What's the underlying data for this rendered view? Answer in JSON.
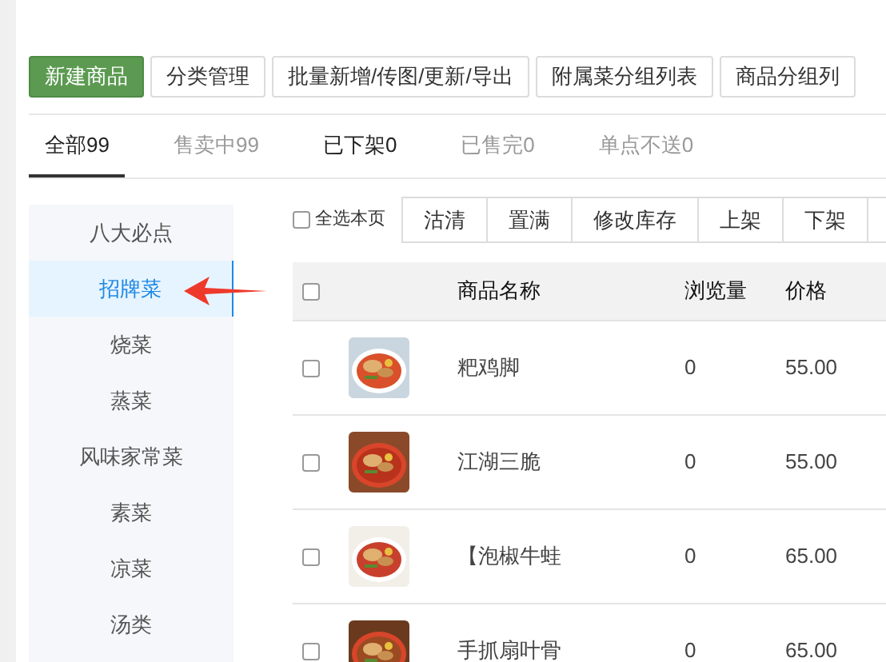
{
  "actions": [
    {
      "label": "新建商品",
      "kind": "primary"
    },
    {
      "label": "分类管理",
      "kind": "default"
    },
    {
      "label": "批量新增/传图/更新/导出",
      "kind": "default"
    },
    {
      "label": "附属菜分组列表",
      "kind": "default"
    },
    {
      "label": "商品分组列",
      "kind": "default"
    }
  ],
  "tabs": [
    {
      "label": "全部99",
      "selected": true,
      "muted": false
    },
    {
      "label": "售卖中99",
      "selected": false,
      "muted": true
    },
    {
      "label": "已下架0",
      "selected": false,
      "muted": false
    },
    {
      "label": "已售完0",
      "selected": false,
      "muted": true
    },
    {
      "label": "单点不送0",
      "selected": false,
      "muted": true
    }
  ],
  "categories": [
    {
      "label": "八大必点",
      "selected": false
    },
    {
      "label": "招牌菜",
      "selected": true
    },
    {
      "label": "烧菜",
      "selected": false
    },
    {
      "label": "蒸菜",
      "selected": false
    },
    {
      "label": "风味家常菜",
      "selected": false
    },
    {
      "label": "素菜",
      "selected": false
    },
    {
      "label": "凉菜",
      "selected": false
    },
    {
      "label": "汤类",
      "selected": false
    }
  ],
  "toolbar": {
    "select_all": {
      "label": "全选本页",
      "checked": false
    },
    "buttons": [
      "沽清",
      "置满",
      "修改库存",
      "上架",
      "下架"
    ]
  },
  "table": {
    "header_checked": false,
    "columns": [
      "商品名称",
      "浏览量",
      "价格"
    ],
    "rows": [
      {
        "checked": false,
        "name": "粑鸡脚",
        "views": "0",
        "price": "55.00"
      },
      {
        "checked": false,
        "name": "江湖三脆",
        "views": "0",
        "price": "55.00"
      },
      {
        "checked": false,
        "name": "【泡椒牛蛙",
        "views": "0",
        "price": "65.00"
      },
      {
        "checked": false,
        "name": "手抓扇叶骨",
        "views": "0",
        "price": "65.00"
      }
    ]
  }
}
